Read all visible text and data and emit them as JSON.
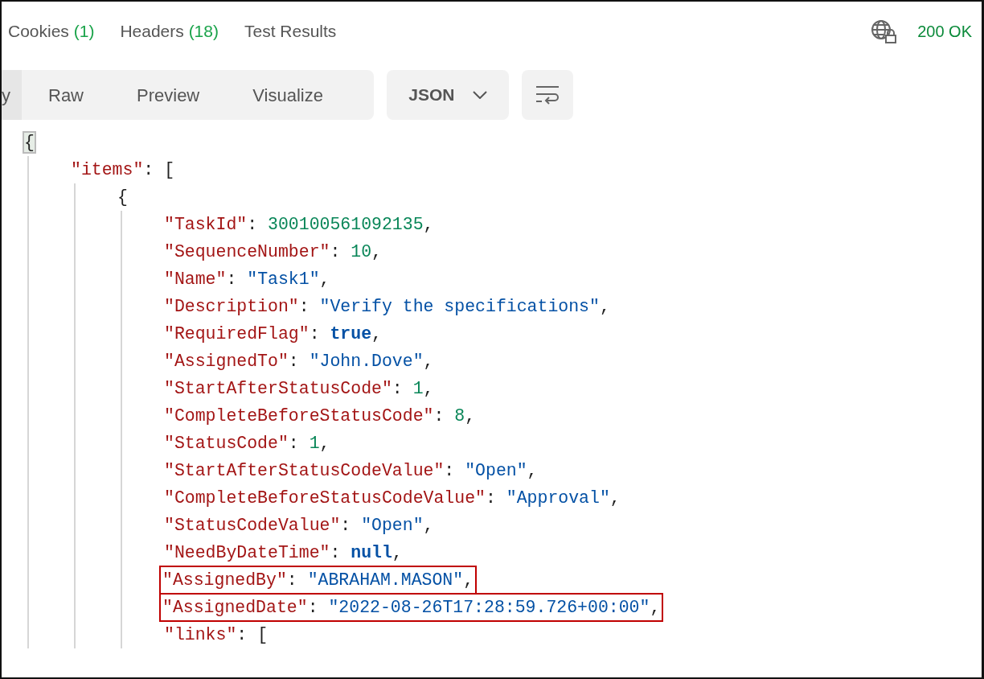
{
  "response_tabs": [
    {
      "label": "Cookies",
      "count": "(1)"
    },
    {
      "label": "Headers",
      "count": "(18)"
    },
    {
      "label": "Test Results"
    }
  ],
  "status": "200 OK",
  "view_tabs": [
    {
      "label": "y",
      "selected": true
    },
    {
      "label": "Raw",
      "selected": false
    },
    {
      "label": "Preview",
      "selected": false
    },
    {
      "label": "Visualize",
      "selected": false
    }
  ],
  "format_dropdown": "JSON",
  "body": {
    "tokens": [
      {
        "kind": "bracket",
        "text": "{"
      }
    ],
    "matched": true,
    "children": [
      {
        "tokens": [
          {
            "kind": "key",
            "text": "\"items\""
          },
          {
            "kind": "punct",
            "text": ": "
          },
          {
            "kind": "bracket",
            "text": "["
          }
        ],
        "matched": false,
        "children": [
          {
            "tokens": [
              {
                "kind": "bracket",
                "text": "{"
              }
            ],
            "matched": false,
            "children": [
              {
                "tokens": [
                  {
                    "kind": "key",
                    "text": "\"TaskId\""
                  },
                  {
                    "kind": "punct",
                    "text": ": "
                  },
                  {
                    "kind": "number",
                    "text": "300100561092135"
                  },
                  {
                    "kind": "punct",
                    "text": ","
                  }
                ],
                "highlighted": false
              },
              {
                "tokens": [
                  {
                    "kind": "key",
                    "text": "\"SequenceNumber\""
                  },
                  {
                    "kind": "punct",
                    "text": ": "
                  },
                  {
                    "kind": "number",
                    "text": "10"
                  },
                  {
                    "kind": "punct",
                    "text": ","
                  }
                ],
                "highlighted": false
              },
              {
                "tokens": [
                  {
                    "kind": "key",
                    "text": "\"Name\""
                  },
                  {
                    "kind": "punct",
                    "text": ": "
                  },
                  {
                    "kind": "string",
                    "text": "\"Task1\""
                  },
                  {
                    "kind": "punct",
                    "text": ","
                  }
                ],
                "highlighted": false
              },
              {
                "tokens": [
                  {
                    "kind": "key",
                    "text": "\"Description\""
                  },
                  {
                    "kind": "punct",
                    "text": ": "
                  },
                  {
                    "kind": "string",
                    "text": "\"Verify the specifications\""
                  },
                  {
                    "kind": "punct",
                    "text": ","
                  }
                ],
                "highlighted": false
              },
              {
                "tokens": [
                  {
                    "kind": "key",
                    "text": "\"RequiredFlag\""
                  },
                  {
                    "kind": "punct",
                    "text": ": "
                  },
                  {
                    "kind": "literal",
                    "text": "true"
                  },
                  {
                    "kind": "punct",
                    "text": ","
                  }
                ],
                "highlighted": false
              },
              {
                "tokens": [
                  {
                    "kind": "key",
                    "text": "\"AssignedTo\""
                  },
                  {
                    "kind": "punct",
                    "text": ": "
                  },
                  {
                    "kind": "string",
                    "text": "\"John.Dove\""
                  },
                  {
                    "kind": "punct",
                    "text": ","
                  }
                ],
                "highlighted": false
              },
              {
                "tokens": [
                  {
                    "kind": "key",
                    "text": "\"StartAfterStatusCode\""
                  },
                  {
                    "kind": "punct",
                    "text": ": "
                  },
                  {
                    "kind": "number",
                    "text": "1"
                  },
                  {
                    "kind": "punct",
                    "text": ","
                  }
                ],
                "highlighted": false
              },
              {
                "tokens": [
                  {
                    "kind": "key",
                    "text": "\"CompleteBeforeStatusCode\""
                  },
                  {
                    "kind": "punct",
                    "text": ": "
                  },
                  {
                    "kind": "number",
                    "text": "8"
                  },
                  {
                    "kind": "punct",
                    "text": ","
                  }
                ],
                "highlighted": false
              },
              {
                "tokens": [
                  {
                    "kind": "key",
                    "text": "\"StatusCode\""
                  },
                  {
                    "kind": "punct",
                    "text": ": "
                  },
                  {
                    "kind": "number",
                    "text": "1"
                  },
                  {
                    "kind": "punct",
                    "text": ","
                  }
                ],
                "highlighted": false
              },
              {
                "tokens": [
                  {
                    "kind": "key",
                    "text": "\"StartAfterStatusCodeValue\""
                  },
                  {
                    "kind": "punct",
                    "text": ": "
                  },
                  {
                    "kind": "string",
                    "text": "\"Open\""
                  },
                  {
                    "kind": "punct",
                    "text": ","
                  }
                ],
                "highlighted": false
              },
              {
                "tokens": [
                  {
                    "kind": "key",
                    "text": "\"CompleteBeforeStatusCodeValue\""
                  },
                  {
                    "kind": "punct",
                    "text": ": "
                  },
                  {
                    "kind": "string",
                    "text": "\"Approval\""
                  },
                  {
                    "kind": "punct",
                    "text": ","
                  }
                ],
                "highlighted": false
              },
              {
                "tokens": [
                  {
                    "kind": "key",
                    "text": "\"StatusCodeValue\""
                  },
                  {
                    "kind": "punct",
                    "text": ": "
                  },
                  {
                    "kind": "string",
                    "text": "\"Open\""
                  },
                  {
                    "kind": "punct",
                    "text": ","
                  }
                ],
                "highlighted": false
              },
              {
                "tokens": [
                  {
                    "kind": "key",
                    "text": "\"NeedByDateTime\""
                  },
                  {
                    "kind": "punct",
                    "text": ": "
                  },
                  {
                    "kind": "literal",
                    "text": "null"
                  },
                  {
                    "kind": "punct",
                    "text": ","
                  }
                ],
                "highlighted": false
              },
              {
                "tokens": [
                  {
                    "kind": "key",
                    "text": "\"AssignedBy\""
                  },
                  {
                    "kind": "punct",
                    "text": ": "
                  },
                  {
                    "kind": "string",
                    "text": "\"ABRAHAM.MASON\""
                  },
                  {
                    "kind": "punct",
                    "text": ","
                  }
                ],
                "highlighted": true
              },
              {
                "tokens": [
                  {
                    "kind": "key",
                    "text": "\"AssignedDate\""
                  },
                  {
                    "kind": "punct",
                    "text": ": "
                  },
                  {
                    "kind": "string",
                    "text": "\"2022-08-26T17:28:59.726+00:00\""
                  },
                  {
                    "kind": "punct",
                    "text": ","
                  }
                ],
                "highlighted": true
              },
              {
                "tokens": [
                  {
                    "kind": "key",
                    "text": "\"links\""
                  },
                  {
                    "kind": "punct",
                    "text": ": "
                  },
                  {
                    "kind": "bracket",
                    "text": "["
                  }
                ],
                "highlighted": false
              }
            ]
          }
        ]
      }
    ]
  }
}
